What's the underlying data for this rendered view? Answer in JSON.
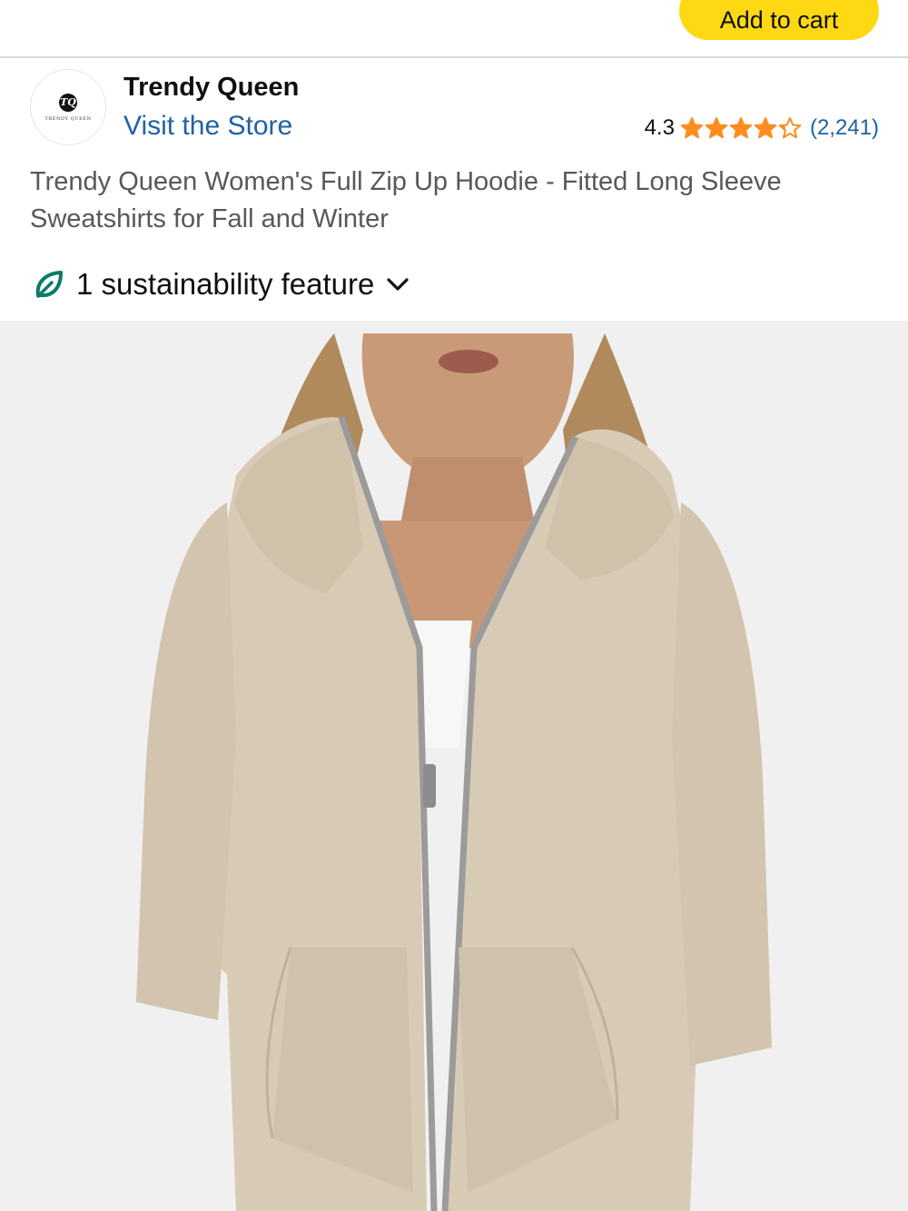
{
  "cart": {
    "add_label": "Add to cart"
  },
  "brand": {
    "logo_text": "TRENDY QUEEN",
    "logo_mark": "TQ",
    "name": "Trendy Queen",
    "store_link": "Visit the Store"
  },
  "rating": {
    "value": "4.3",
    "stars_filled": 4.3,
    "stars_total": 5,
    "review_count": "(2,241)"
  },
  "product": {
    "title": "Trendy Queen Women's Full Zip Up Hoodie - Fitted Long Sleeve Sweatshirts for Fall and Winter"
  },
  "sustainability": {
    "label": "1 sustainability feature",
    "icon": "leaf-icon"
  },
  "image": {
    "subject": "beige-zip-up-hoodie"
  },
  "colors": {
    "cart_button": "#ffd814",
    "link": "#2162a1",
    "star": "#ff8c21",
    "leaf": "#0a7a6b",
    "hoodie": "#d8cbb6",
    "image_bg": "#f0f0f0"
  }
}
